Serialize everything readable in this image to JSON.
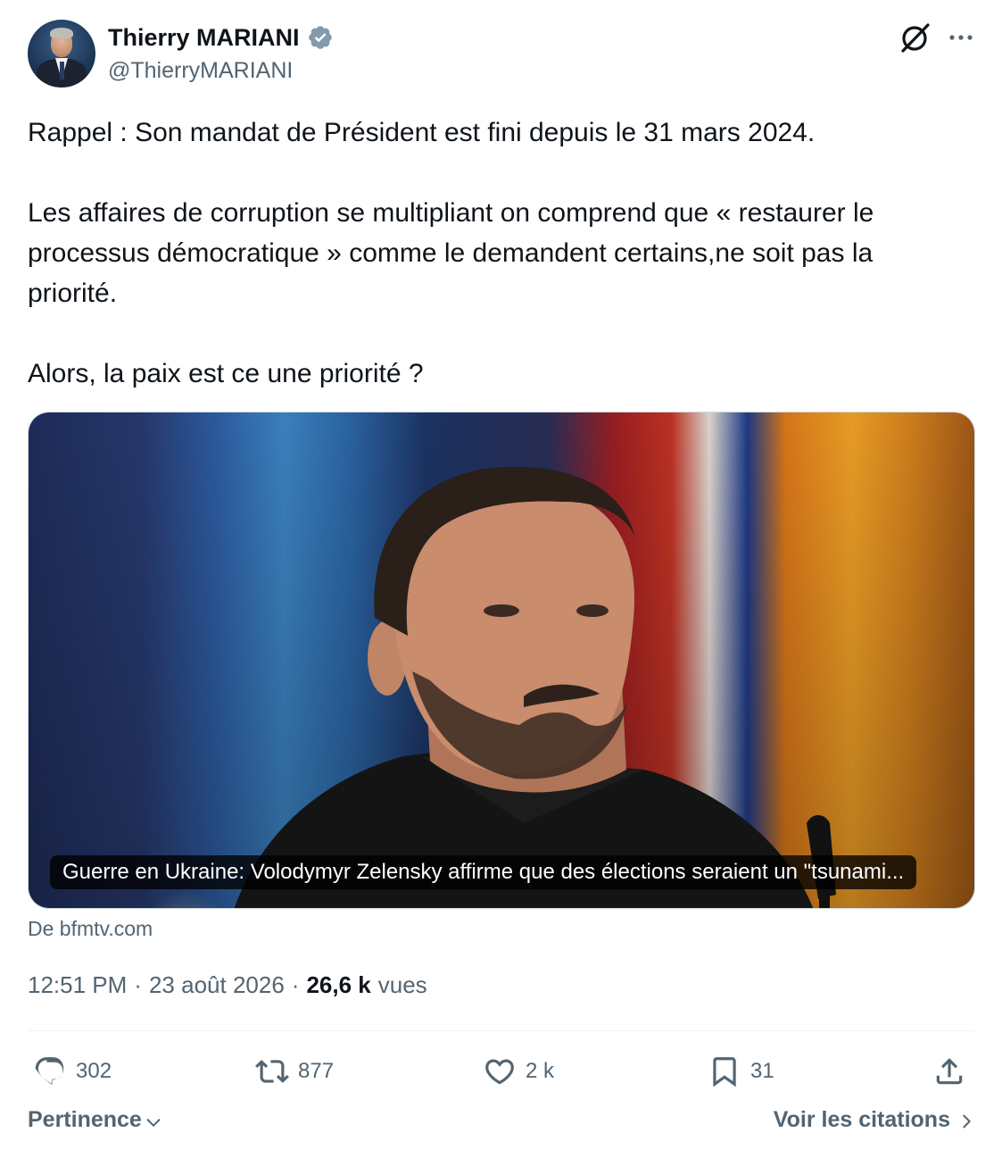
{
  "author": {
    "display_name": "Thierry MARIANI",
    "handle": "@ThierryMARIANI",
    "verified_icon": "verified-badge-icon",
    "verified_color": "#829aab"
  },
  "tweet": {
    "paragraphs": [
      "Rappel : Son mandat de Président est fini depuis le 31 mars 2024.",
      "Les affaires de corruption se multipliant on comprend que « restaurer le\nprocessus démocratique » comme le demandent certains,ne soit pas la\npriorité.",
      "Alors, la paix est ce une priorité ?"
    ]
  },
  "media": {
    "caption": "Guerre en Ukraine: Volodymyr Zelensky affirme que des élections seraient un \"tsunami...",
    "source": "De bfmtv.com"
  },
  "meta": {
    "time": "12:51 PM",
    "separator": "·",
    "date": "23 août 2026",
    "views_count": "26,6 k",
    "views_label": "vues"
  },
  "actions": {
    "replies": "302",
    "reposts": "877",
    "likes": "2 k",
    "bookmarks": "31"
  },
  "footer": {
    "sort_label": "Pertinence",
    "quotes_label": "Voir les citations"
  },
  "colors": {
    "text_primary": "#0f1419",
    "text_secondary": "#536471",
    "divider": "#eff3f4"
  }
}
